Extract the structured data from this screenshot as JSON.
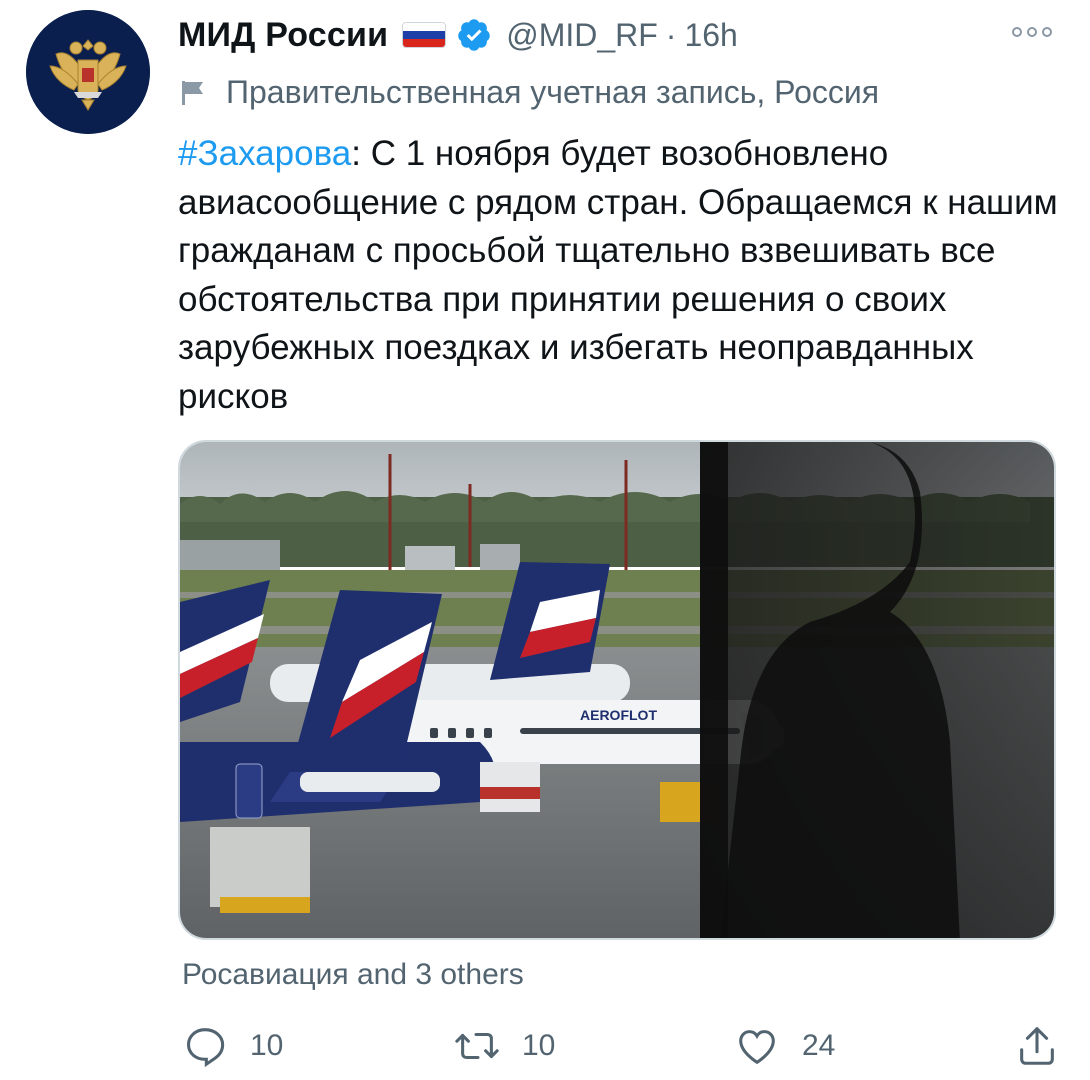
{
  "author": {
    "display_name": "МИД России",
    "flag_emoji": "russia-flag",
    "verified_icon": "verified-badge-icon",
    "handle": "@MID_RF",
    "separator": "·",
    "timestamp": "16h",
    "label": "Правительственная учетная запись, Россия"
  },
  "tweet": {
    "hashtag": "#Захарова",
    "text": ":  С 1 ноября будет возобновлено авиасообщение с рядом стран. Обращаемся к нашим гражданам с просьбой тщательно взвешивать все обстоятельства при принятии решения о своих зарубежных поездках и избегать неоправданных рисков",
    "media_description_icon": "photo-airport-aeroflot-planes",
    "media_text": "AEROFLOT"
  },
  "tagged": "Росавиация and 3 others",
  "actions": {
    "reply_count": "10",
    "retweet_count": "10",
    "like_count": "24"
  },
  "colors": {
    "accent": "#1d9bf0",
    "secondary_text": "#536471",
    "flag_white": "#ffffff",
    "flag_blue": "#1c3fa8",
    "flag_red": "#d8261d"
  }
}
